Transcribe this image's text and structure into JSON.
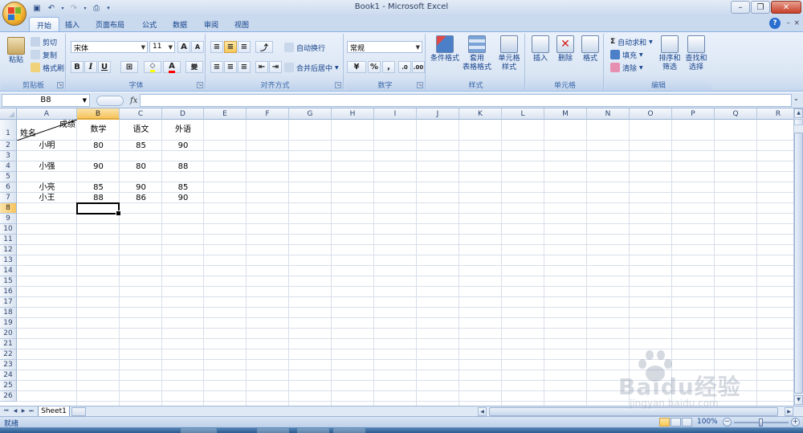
{
  "window": {
    "title": "Book1 - Microsoft Excel",
    "controls": [
      "–",
      "❐",
      "✕"
    ]
  },
  "tabs": [
    {
      "label": "开始",
      "active": true
    },
    {
      "label": "插入"
    },
    {
      "label": "页面布局"
    },
    {
      "label": "公式"
    },
    {
      "label": "数据"
    },
    {
      "label": "审阅"
    },
    {
      "label": "视图"
    }
  ],
  "ribbon": {
    "clipboard": {
      "label": "剪贴板",
      "paste": "粘贴",
      "cut": "剪切",
      "copy": "复制",
      "format_painter": "格式刷"
    },
    "font": {
      "label": "字体",
      "font_name": "宋体",
      "font_size": "11",
      "bold": "B",
      "italic": "I",
      "underline": "U",
      "grow": "A",
      "shrink": "A",
      "font_color": "A",
      "wen": "變"
    },
    "alignment": {
      "label": "对齐方式",
      "wrap": "自动换行",
      "merge": "合并后居中"
    },
    "number": {
      "label": "数字",
      "format": "常规",
      "percent": "%",
      "comma": ","
    },
    "styles": {
      "label": "样式",
      "conditional": "条件格式",
      "table_line1": "套用",
      "table_line2": "表格格式",
      "cell_line1": "单元格",
      "cell_line2": "样式"
    },
    "cells": {
      "label": "单元格",
      "insert": "插入",
      "delete": "删除",
      "format": "格式"
    },
    "editing": {
      "label": "编辑",
      "autosum": "自动求和",
      "fill": "填充",
      "clear": "清除",
      "sort_line1": "排序和",
      "sort_line2": "筛选",
      "find_line1": "查找和",
      "find_line2": "选择"
    }
  },
  "formula_bar": {
    "name_box": "B8",
    "fx": "fx",
    "content": ""
  },
  "columns": [
    "A",
    "B",
    "C",
    "D",
    "E",
    "F",
    "G",
    "H",
    "I",
    "J",
    "K",
    "L",
    "M",
    "N",
    "O",
    "P",
    "Q",
    "R"
  ],
  "selected_column": "B",
  "rows": [
    "1",
    "2",
    "3",
    "4",
    "5",
    "6",
    "7",
    "8",
    "9",
    "10",
    "11",
    "12",
    "13",
    "14",
    "15",
    "16",
    "17",
    "18",
    "19",
    "20",
    "21",
    "22",
    "23",
    "24",
    "25",
    "26"
  ],
  "selected_row": "8",
  "cells": {
    "a1_name": "姓名",
    "a1_score": "成绩",
    "b1": "数学",
    "c1": "语文",
    "d1": "外语",
    "a2": "小明",
    "b2": "80",
    "c2": "85",
    "d2": "90",
    "a4": "小强",
    "b4": "90",
    "c4": "80",
    "d4": "88",
    "a6": "小亮",
    "b6": "85",
    "c6": "90",
    "d6": "85",
    "a7": "小王",
    "b7": "88",
    "c7": "86",
    "d7": "90"
  },
  "sheets": [
    {
      "label": "Sheet1",
      "active": true
    }
  ],
  "status": {
    "text": "就绪",
    "zoom": "100%"
  },
  "watermark": {
    "brand": "Baidu经验",
    "url": "jingyan.baidu.com"
  }
}
